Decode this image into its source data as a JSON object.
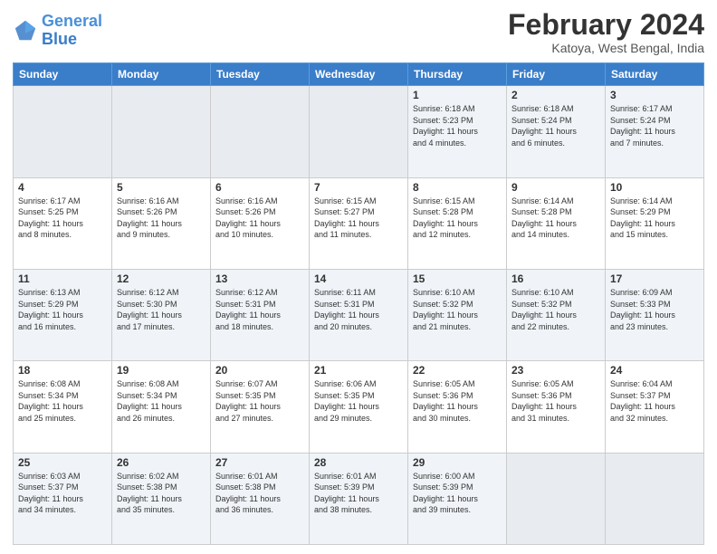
{
  "logo": {
    "text_general": "General",
    "text_blue": "Blue"
  },
  "header": {
    "month_year": "February 2024",
    "location": "Katoya, West Bengal, India"
  },
  "weekdays": [
    "Sunday",
    "Monday",
    "Tuesday",
    "Wednesday",
    "Thursday",
    "Friday",
    "Saturday"
  ],
  "weeks": [
    [
      {
        "day": "",
        "info": "",
        "empty": true
      },
      {
        "day": "",
        "info": "",
        "empty": true
      },
      {
        "day": "",
        "info": "",
        "empty": true
      },
      {
        "day": "",
        "info": "",
        "empty": true
      },
      {
        "day": "1",
        "info": "Sunrise: 6:18 AM\nSunset: 5:23 PM\nDaylight: 11 hours\nand 4 minutes."
      },
      {
        "day": "2",
        "info": "Sunrise: 6:18 AM\nSunset: 5:24 PM\nDaylight: 11 hours\nand 6 minutes."
      },
      {
        "day": "3",
        "info": "Sunrise: 6:17 AM\nSunset: 5:24 PM\nDaylight: 11 hours\nand 7 minutes."
      }
    ],
    [
      {
        "day": "4",
        "info": "Sunrise: 6:17 AM\nSunset: 5:25 PM\nDaylight: 11 hours\nand 8 minutes."
      },
      {
        "day": "5",
        "info": "Sunrise: 6:16 AM\nSunset: 5:26 PM\nDaylight: 11 hours\nand 9 minutes."
      },
      {
        "day": "6",
        "info": "Sunrise: 6:16 AM\nSunset: 5:26 PM\nDaylight: 11 hours\nand 10 minutes."
      },
      {
        "day": "7",
        "info": "Sunrise: 6:15 AM\nSunset: 5:27 PM\nDaylight: 11 hours\nand 11 minutes."
      },
      {
        "day": "8",
        "info": "Sunrise: 6:15 AM\nSunset: 5:28 PM\nDaylight: 11 hours\nand 12 minutes."
      },
      {
        "day": "9",
        "info": "Sunrise: 6:14 AM\nSunset: 5:28 PM\nDaylight: 11 hours\nand 14 minutes."
      },
      {
        "day": "10",
        "info": "Sunrise: 6:14 AM\nSunset: 5:29 PM\nDaylight: 11 hours\nand 15 minutes."
      }
    ],
    [
      {
        "day": "11",
        "info": "Sunrise: 6:13 AM\nSunset: 5:29 PM\nDaylight: 11 hours\nand 16 minutes."
      },
      {
        "day": "12",
        "info": "Sunrise: 6:12 AM\nSunset: 5:30 PM\nDaylight: 11 hours\nand 17 minutes."
      },
      {
        "day": "13",
        "info": "Sunrise: 6:12 AM\nSunset: 5:31 PM\nDaylight: 11 hours\nand 18 minutes."
      },
      {
        "day": "14",
        "info": "Sunrise: 6:11 AM\nSunset: 5:31 PM\nDaylight: 11 hours\nand 20 minutes."
      },
      {
        "day": "15",
        "info": "Sunrise: 6:10 AM\nSunset: 5:32 PM\nDaylight: 11 hours\nand 21 minutes."
      },
      {
        "day": "16",
        "info": "Sunrise: 6:10 AM\nSunset: 5:32 PM\nDaylight: 11 hours\nand 22 minutes."
      },
      {
        "day": "17",
        "info": "Sunrise: 6:09 AM\nSunset: 5:33 PM\nDaylight: 11 hours\nand 23 minutes."
      }
    ],
    [
      {
        "day": "18",
        "info": "Sunrise: 6:08 AM\nSunset: 5:34 PM\nDaylight: 11 hours\nand 25 minutes."
      },
      {
        "day": "19",
        "info": "Sunrise: 6:08 AM\nSunset: 5:34 PM\nDaylight: 11 hours\nand 26 minutes."
      },
      {
        "day": "20",
        "info": "Sunrise: 6:07 AM\nSunset: 5:35 PM\nDaylight: 11 hours\nand 27 minutes."
      },
      {
        "day": "21",
        "info": "Sunrise: 6:06 AM\nSunset: 5:35 PM\nDaylight: 11 hours\nand 29 minutes."
      },
      {
        "day": "22",
        "info": "Sunrise: 6:05 AM\nSunset: 5:36 PM\nDaylight: 11 hours\nand 30 minutes."
      },
      {
        "day": "23",
        "info": "Sunrise: 6:05 AM\nSunset: 5:36 PM\nDaylight: 11 hours\nand 31 minutes."
      },
      {
        "day": "24",
        "info": "Sunrise: 6:04 AM\nSunset: 5:37 PM\nDaylight: 11 hours\nand 32 minutes."
      }
    ],
    [
      {
        "day": "25",
        "info": "Sunrise: 6:03 AM\nSunset: 5:37 PM\nDaylight: 11 hours\nand 34 minutes."
      },
      {
        "day": "26",
        "info": "Sunrise: 6:02 AM\nSunset: 5:38 PM\nDaylight: 11 hours\nand 35 minutes."
      },
      {
        "day": "27",
        "info": "Sunrise: 6:01 AM\nSunset: 5:38 PM\nDaylight: 11 hours\nand 36 minutes."
      },
      {
        "day": "28",
        "info": "Sunrise: 6:01 AM\nSunset: 5:39 PM\nDaylight: 11 hours\nand 38 minutes."
      },
      {
        "day": "29",
        "info": "Sunrise: 6:00 AM\nSunset: 5:39 PM\nDaylight: 11 hours\nand 39 minutes."
      },
      {
        "day": "",
        "info": "",
        "empty": true
      },
      {
        "day": "",
        "info": "",
        "empty": true
      }
    ]
  ]
}
